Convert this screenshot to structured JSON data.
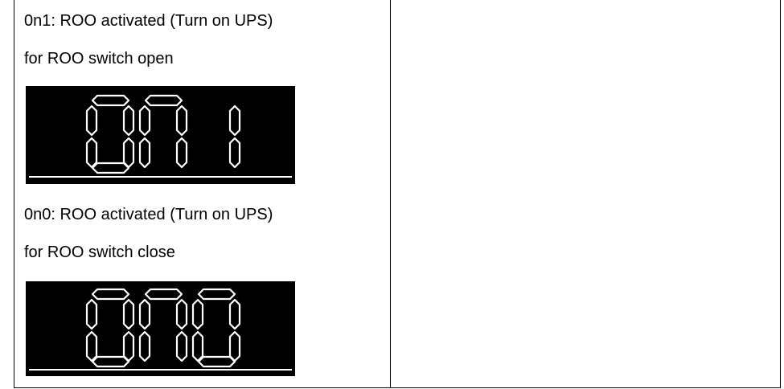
{
  "rows": [
    {
      "line1": "0n1: ROO activated (Turn on UPS)",
      "line2": "for ROO switch open",
      "display": "0n1",
      "display_label": "ON 1"
    },
    {
      "line1": "0n0: ROO activated (Turn on UPS)",
      "line2": "for ROO switch close",
      "display": "0n0",
      "display_label": "ONO"
    }
  ],
  "colors": {
    "lcd_background": "#000000",
    "segment": "#ffffff"
  }
}
